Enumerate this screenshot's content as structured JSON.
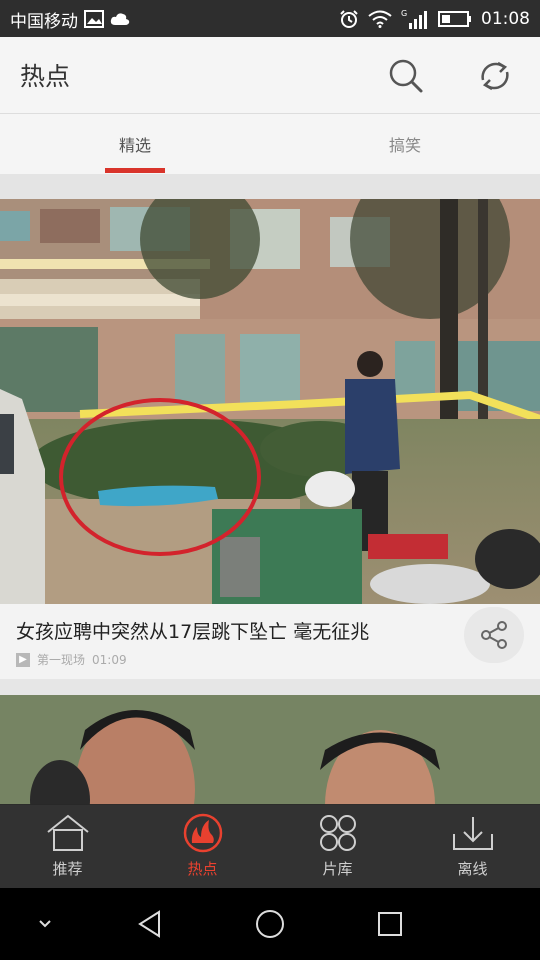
{
  "status_bar": {
    "carrier": "中国移动",
    "time": "01:08",
    "network": "G",
    "icons": [
      "image-icon",
      "cloud-icon",
      "alarm-icon",
      "wifi-icon",
      "signal-icon",
      "battery-icon"
    ]
  },
  "header": {
    "title": "热点",
    "search_icon": "search-icon",
    "refresh_icon": "refresh-icon"
  },
  "tabs": [
    {
      "label": "精选",
      "active": true
    },
    {
      "label": "搞笑",
      "active": false
    }
  ],
  "feed": [
    {
      "title": "女孩应聘中突然从17层跳下坠亡 毫无征兆",
      "source": "第一现场",
      "duration": "01:09",
      "share_icon": "share-icon"
    }
  ],
  "bottom_nav": [
    {
      "label": "推荐",
      "icon": "home-icon",
      "active": false
    },
    {
      "label": "热点",
      "icon": "flame-icon",
      "active": true
    },
    {
      "label": "片库",
      "icon": "grid-icon",
      "active": false
    },
    {
      "label": "离线",
      "icon": "download-icon",
      "active": false
    }
  ],
  "colors": {
    "accent": "#d9342b",
    "active_nav": "#e8412f"
  }
}
